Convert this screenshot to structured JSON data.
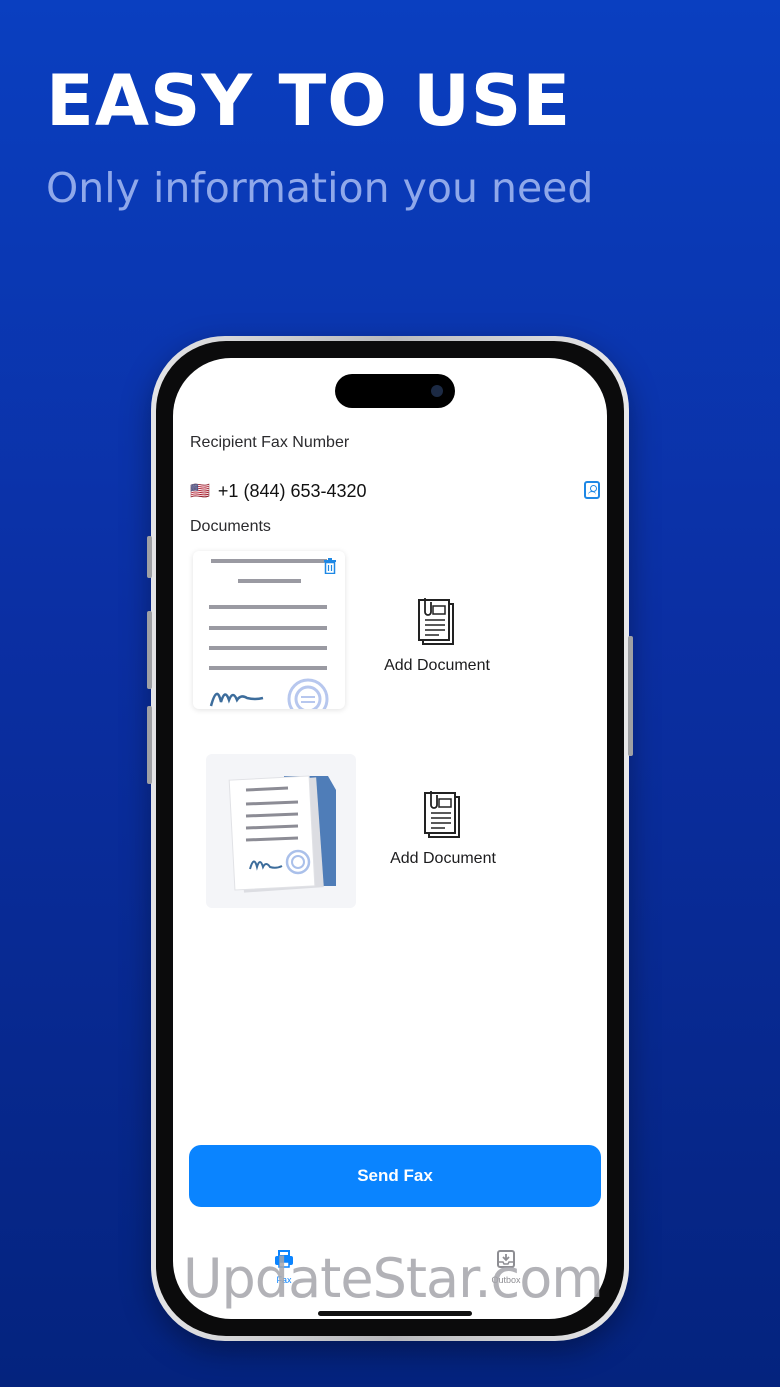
{
  "promo": {
    "headline": "EASY TO USE",
    "subheadline": "Only information you need"
  },
  "form": {
    "recipient_label": "Recipient Fax Number",
    "country_flag": "🇺🇸",
    "fax_number": "+1 (844) 653-4320",
    "documents_label": "Documents"
  },
  "documents": [
    {
      "add_label": "Add Document"
    },
    {
      "add_label": "Add Document"
    }
  ],
  "actions": {
    "send_label": "Send Fax"
  },
  "tabbar": {
    "tabs": [
      {
        "label": "Fax",
        "icon": "fax-icon",
        "active": true
      },
      {
        "label": "Outbox",
        "icon": "outbox-icon",
        "active": false
      }
    ]
  },
  "watermark": "UpdateStar.com",
  "colors": {
    "accent": "#0a84ff",
    "background_top": "#0a3fc0",
    "background_bottom": "#04237e"
  }
}
